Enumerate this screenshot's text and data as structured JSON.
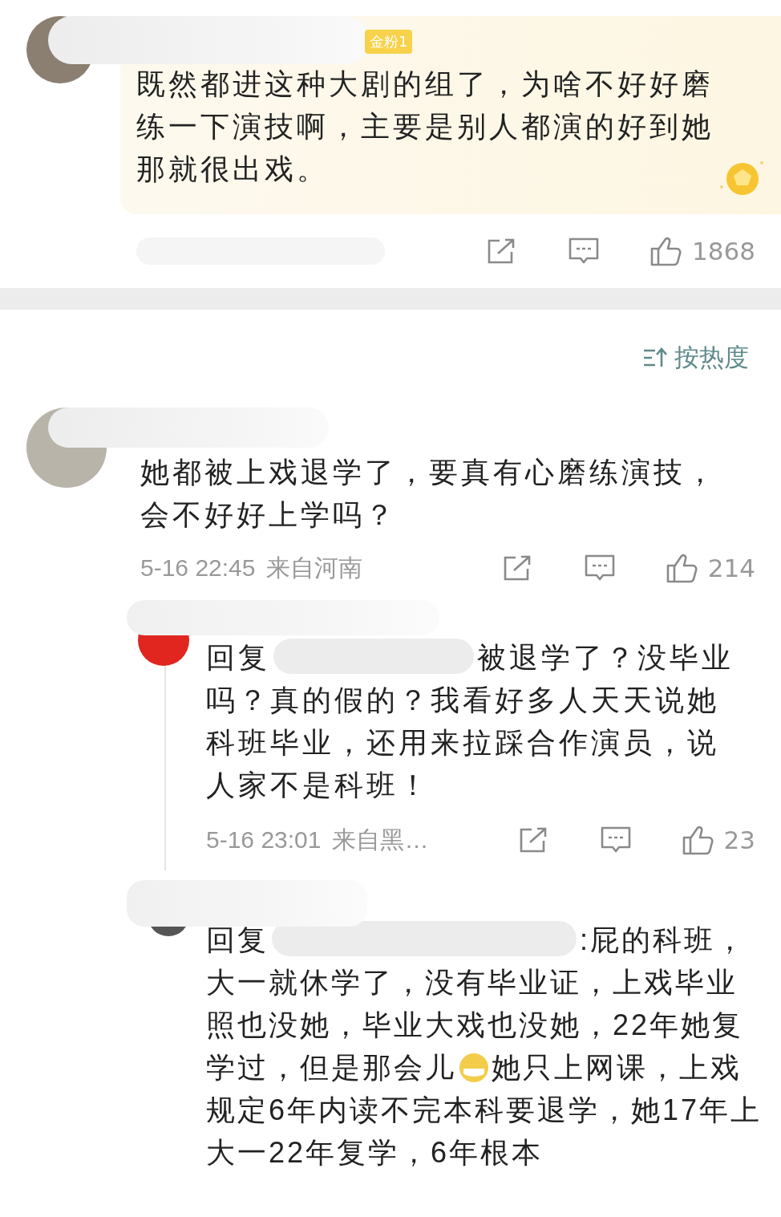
{
  "comments": [
    {
      "kind": "featured",
      "badge": "金粉1",
      "segments": [
        {
          "kind": "text",
          "text": "既然都进这种大剧的组了，为啥不好好磨练一下演技啊，主要是别人都演的好到她那就很出戏。"
        }
      ],
      "likes": "1868"
    },
    {
      "kind": "plain",
      "segments": [
        {
          "kind": "text",
          "text": "她都被上戏退学了，要真有心磨练演技，会不好好上学吗？"
        }
      ],
      "time": "5-16 22:45",
      "location": "来自河南",
      "likes": "214",
      "replies": [
        {
          "segments": [
            {
              "kind": "text",
              "text": "回复"
            },
            {
              "kind": "redacted"
            },
            {
              "kind": "text",
              "text": "被退学了？没毕业吗？真的假的？我看好多人天天说她科班毕业，还用来拉踩合作演员，说人家不是科班！"
            }
          ],
          "time": "5-16 23:01",
          "location": "来自黑…",
          "likes": "23"
        },
        {
          "segments": [
            {
              "kind": "text",
              "text": "回复"
            },
            {
              "kind": "redacted"
            },
            {
              "kind": "text",
              "text": ":屁的科班，大一就休学了，没有毕业证，上戏毕业照也没她，毕业大戏也没她，22年她复学过，但是那会儿"
            },
            {
              "kind": "emoji"
            },
            {
              "kind": "text",
              "text": "她只上网课，上戏规定6年内读不完本科要退学，她17年上大一22年复学，6年根本"
            }
          ]
        }
      ]
    }
  ],
  "sort": {
    "label": "按热度"
  }
}
